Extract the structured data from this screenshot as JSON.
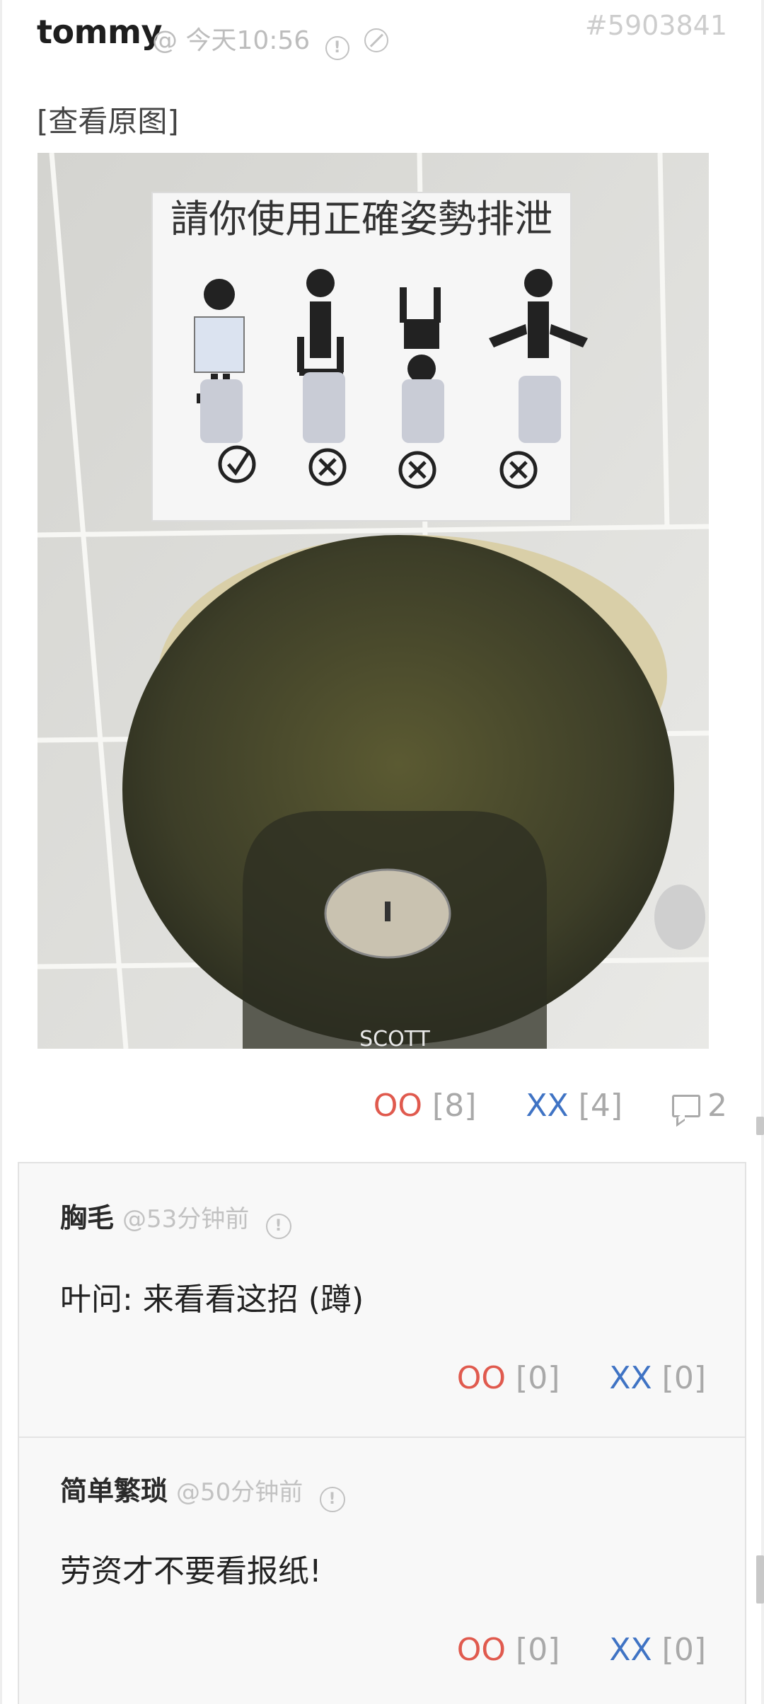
{
  "post": {
    "author": "tommy",
    "meta": "@ 今天10:56",
    "id": "#5903841",
    "view_original": "[查看原图]",
    "image": {
      "sign_title": "請你使用正確姿勢排泄",
      "brand": "SCOTT"
    },
    "votes": {
      "oo_label": "OO",
      "oo_count": "[8]",
      "xx_label": "XX",
      "xx_count": "[4]",
      "comments": "2"
    }
  },
  "comments": [
    {
      "name": "胸毛",
      "time": "@53分钟前",
      "text": "叶问: 来看看这招 (蹲)",
      "oo_label": "OO",
      "oo_count": "[0]",
      "xx_label": "XX",
      "xx_count": "[0]"
    },
    {
      "name": "简单繁琐",
      "time": "@50分钟前",
      "text": "劳资才不要看报纸!",
      "oo_label": "OO",
      "oo_count": "[0]",
      "xx_label": "XX",
      "xx_count": "[0]"
    }
  ],
  "colors": {
    "oo": "#e05a4e",
    "xx": "#3f73c4",
    "muted": "#a9a9a9"
  },
  "icons": [
    "warning-icon",
    "ban-icon",
    "comment-bubble-icon"
  ]
}
